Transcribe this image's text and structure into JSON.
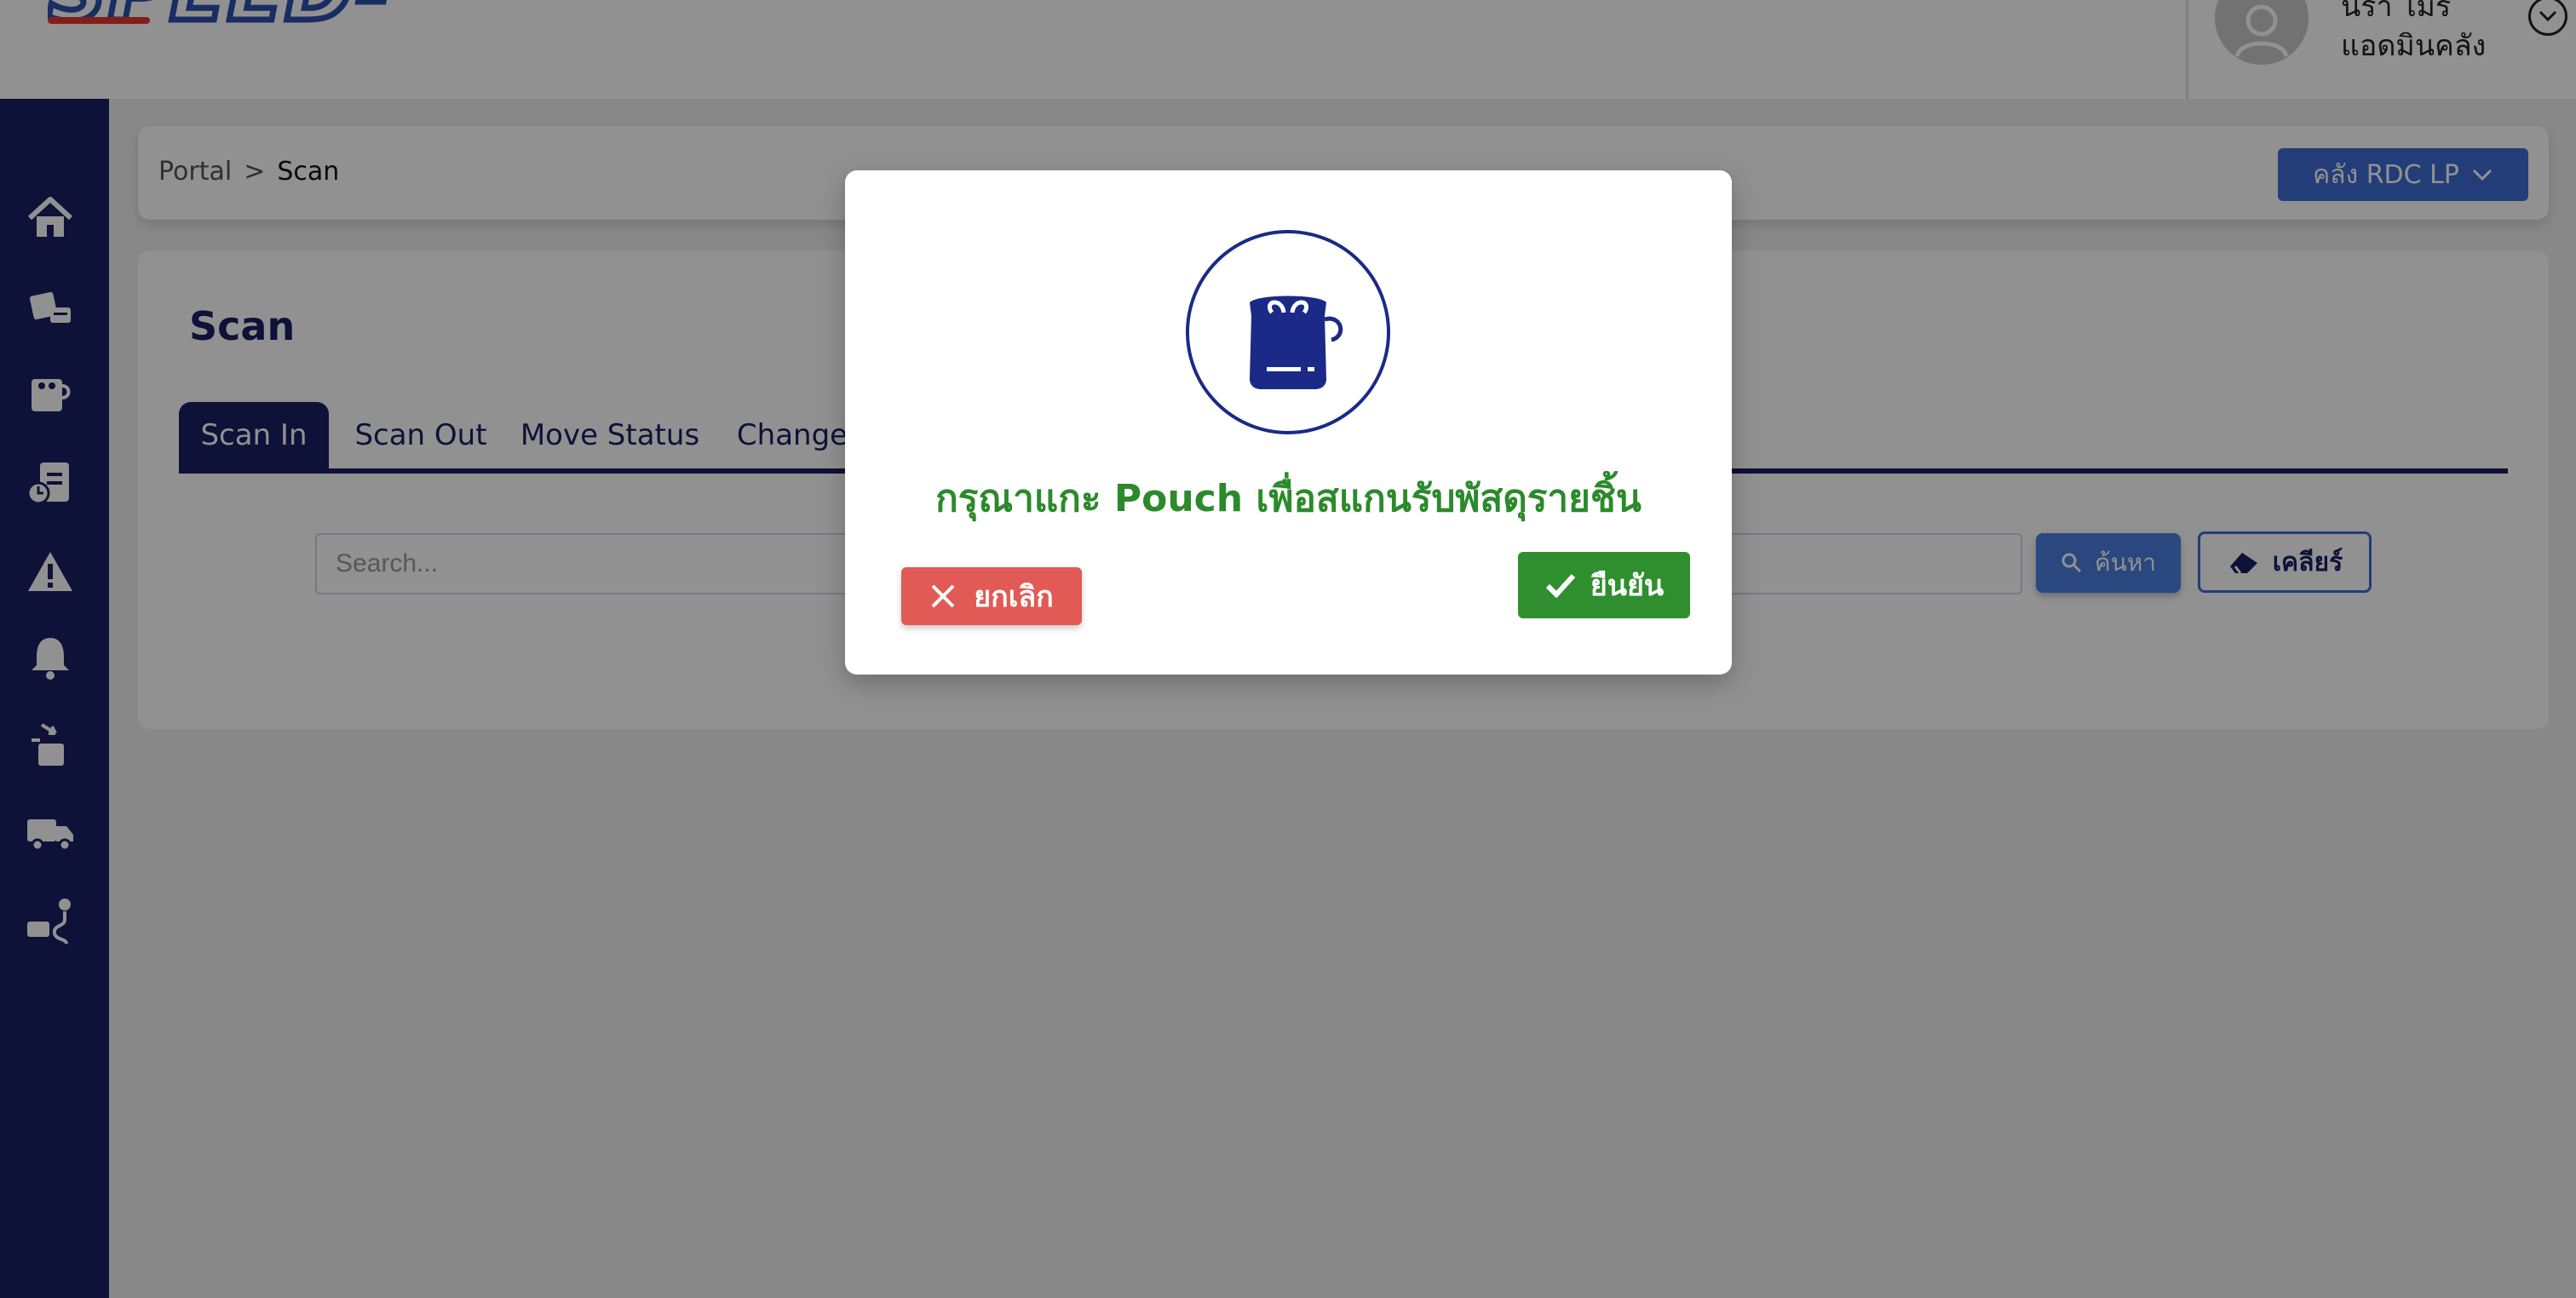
{
  "header": {
    "logo_text": "SPEED-D",
    "user_name": "นิรา ไมร",
    "user_role": "แอดมินคลัง"
  },
  "sidebar": {
    "items": [
      {
        "icon": "home-icon"
      },
      {
        "icon": "parcel-stack-icon"
      },
      {
        "icon": "pouch-box-icon"
      },
      {
        "icon": "report-icon"
      },
      {
        "icon": "warning-icon"
      },
      {
        "icon": "bell-icon"
      },
      {
        "icon": "receive-box-icon"
      },
      {
        "icon": "truck-icon"
      },
      {
        "icon": "route-icon"
      }
    ]
  },
  "breadcrumb": {
    "root": "Portal",
    "separator": ">",
    "current": "Scan"
  },
  "warehouse_selector": {
    "label": "คลัง RDC LP"
  },
  "main": {
    "title": "Scan",
    "tabs": [
      {
        "label": "Scan In",
        "active": true
      },
      {
        "label": "Scan Out",
        "active": false
      },
      {
        "label": "Move Status",
        "active": false
      },
      {
        "label": "Change",
        "active": false
      }
    ],
    "search": {
      "placeholder": "Search..."
    },
    "search_button": "ค้นหา",
    "clear_button": "เคลียร์"
  },
  "modal": {
    "message": "กรุณาแกะ Pouch เพื่อสแกนรับพัสดุรายชิ้น",
    "cancel_label": "ยกเลิก",
    "confirm_label": "ยืนยัน"
  },
  "colors": {
    "navy": "#1a1f63",
    "primary_blue": "#3f6cd3",
    "success_green": "#2f8f2f",
    "danger_red": "#e15a55",
    "message_green": "#2b8a2b"
  }
}
